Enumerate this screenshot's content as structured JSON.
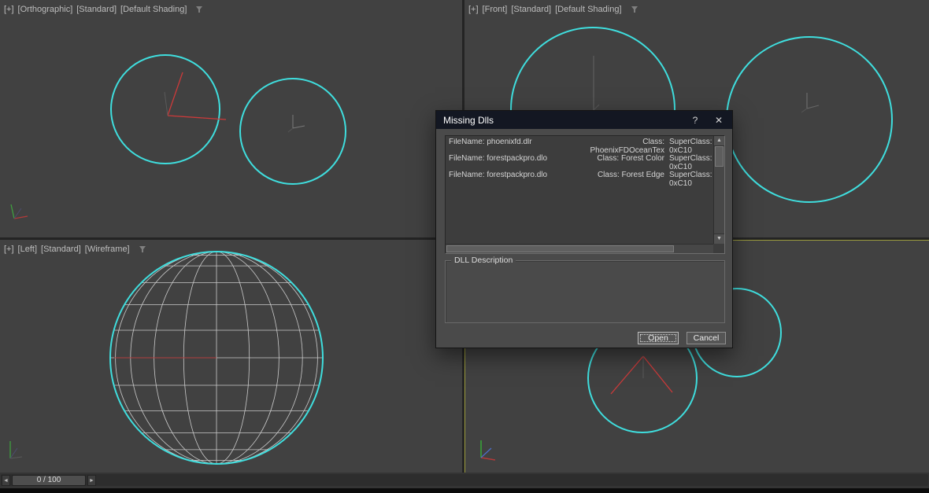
{
  "colors": {
    "accent_cyan": "#3fdede",
    "active_viewport_border": "#9d9d3d",
    "dialog_titlebar": "#131722"
  },
  "viewports": {
    "top_left": {
      "parts": [
        "[+]",
        "[Orthographic]",
        "[Standard]",
        "[Default Shading]"
      ]
    },
    "top_right": {
      "parts": [
        "[+]",
        "[Front]",
        "[Standard]",
        "[Default Shading]"
      ]
    },
    "bottom_left": {
      "parts": [
        "[+]",
        "[Left]",
        "[Standard]",
        "[Wireframe]"
      ]
    }
  },
  "dialog": {
    "title": "Missing Dlls",
    "help_glyph": "?",
    "close_glyph": "✕",
    "rows": [
      {
        "file": "FileName:  phoenixfd.dlr",
        "cls": "Class: PhoenixFDOceanTex",
        "sup": "SuperClass: 0xC10"
      },
      {
        "file": "FileName:  forestpackpro.dlo",
        "cls": "Class: Forest Color",
        "sup": "SuperClass: 0xC10"
      },
      {
        "file": "FileName:  forestpackpro.dlo",
        "cls": "Class: Forest Edge",
        "sup": "SuperClass: 0xC10"
      }
    ],
    "scrollbar": {
      "up": "▲",
      "down": "▼"
    },
    "description_label": "DLL Description",
    "buttons": {
      "open": "Open",
      "cancel": "Cancel"
    }
  },
  "timeline": {
    "prev_glyph": "◄",
    "value": "0 / 100",
    "next_glyph": "►"
  }
}
